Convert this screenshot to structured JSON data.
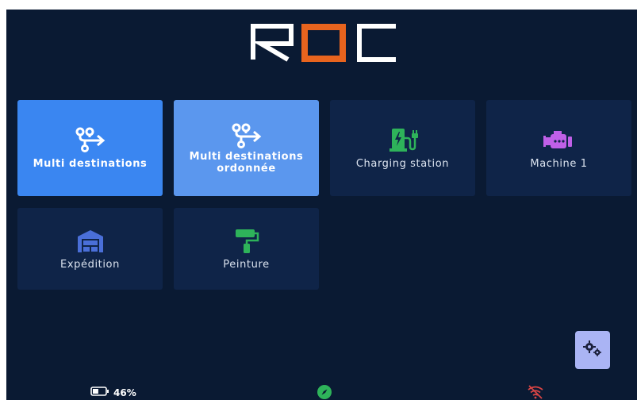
{
  "app": {
    "logo_text": "ROC"
  },
  "tiles": [
    {
      "label": "Multi destinations",
      "icon": "route-multi-icon",
      "state": "selected"
    },
    {
      "label": "Multi destinations ordonnée",
      "icon": "route-multi-icon",
      "state": "selected"
    },
    {
      "label": "Charging station",
      "icon": "charging-station-icon",
      "state": "normal"
    },
    {
      "label": "Machine 1",
      "icon": "engine-icon",
      "state": "normal"
    },
    {
      "label": "Expédition",
      "icon": "warehouse-icon",
      "state": "normal"
    },
    {
      "label": "Peinture",
      "icon": "paint-roller-icon",
      "state": "normal"
    }
  ],
  "status": {
    "battery_percent": "46%",
    "battery_level": 0.46,
    "compass_icon": "compass-icon",
    "wifi_icon": "wifi-off-icon"
  },
  "settings": {
    "icon": "gears-icon"
  },
  "colors": {
    "background": "#0a1a33",
    "tile_selected": "#3a86f1",
    "tile_selected_alt": "#5b97ee",
    "tile_normal": "#0f2448",
    "accent_orange": "#e8641e",
    "charging_green": "#2eb35a",
    "engine_purple": "#c060e8",
    "warehouse_blue": "#4a6fd8",
    "paint_green": "#2eb35a",
    "settings_button": "#aab4f4"
  }
}
